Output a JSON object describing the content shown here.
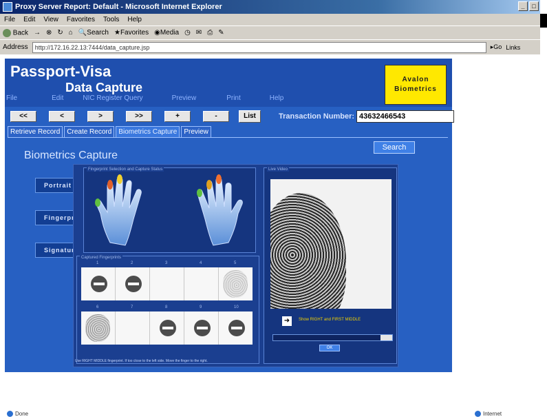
{
  "window": {
    "title": "Proxy Server Report: Default - Microsoft Internet Explorer",
    "menu": [
      "File",
      "Edit",
      "View",
      "Favorites",
      "Tools",
      "Help"
    ],
    "toolbar": [
      "Back",
      "Search",
      "Favorites",
      "Media"
    ],
    "address_label": "Address",
    "address_value": "http://172.16.22.13:7444/data_capture.jsp",
    "go_label": "Go",
    "links_label": "Links",
    "status_left": "Done",
    "status_right": "Internet"
  },
  "app": {
    "title_line1": "Passport-Visa",
    "title_line2": "Data Capture",
    "logo_line1": "Avalon",
    "logo_line2": "Biometrics",
    "menu": [
      "File",
      "Edit",
      "NIC Register Query",
      "Preview",
      "Print",
      "Help"
    ],
    "nav_buttons": [
      "<<",
      "<",
      ">",
      ">>",
      "+",
      "-"
    ],
    "list_button": "List",
    "transaction_label": "Transaction Number:",
    "transaction_value": "43632466543",
    "tabs": [
      "Retrieve Record",
      "Create Record",
      "Biometrics Capture",
      "Preview"
    ],
    "active_tab": "Biometrics Capture",
    "search_button": "Search",
    "section_title": "Biometrics Capture",
    "side_buttons": [
      "Portrait",
      "Fingerprints",
      "Signature"
    ],
    "hands_panel_title": "Fingerprint Selection and Capture Status",
    "fp_panel_title": "Captured Fingerprints",
    "fp_numbers_row1": [
      "1",
      "2",
      "3",
      "4",
      "5"
    ],
    "fp_numbers_row2": [
      "6",
      "7",
      "8",
      "9",
      "10"
    ],
    "live_panel_title": "Live Video",
    "live_message": "Show RIGHT and FIRST MIDDLE",
    "ok_button": "OK",
    "hint": "Use RIGHT MIDDLE fingerprint. If too close to the left side. Move the finger to the right.",
    "progress_fraction": 0.1
  }
}
